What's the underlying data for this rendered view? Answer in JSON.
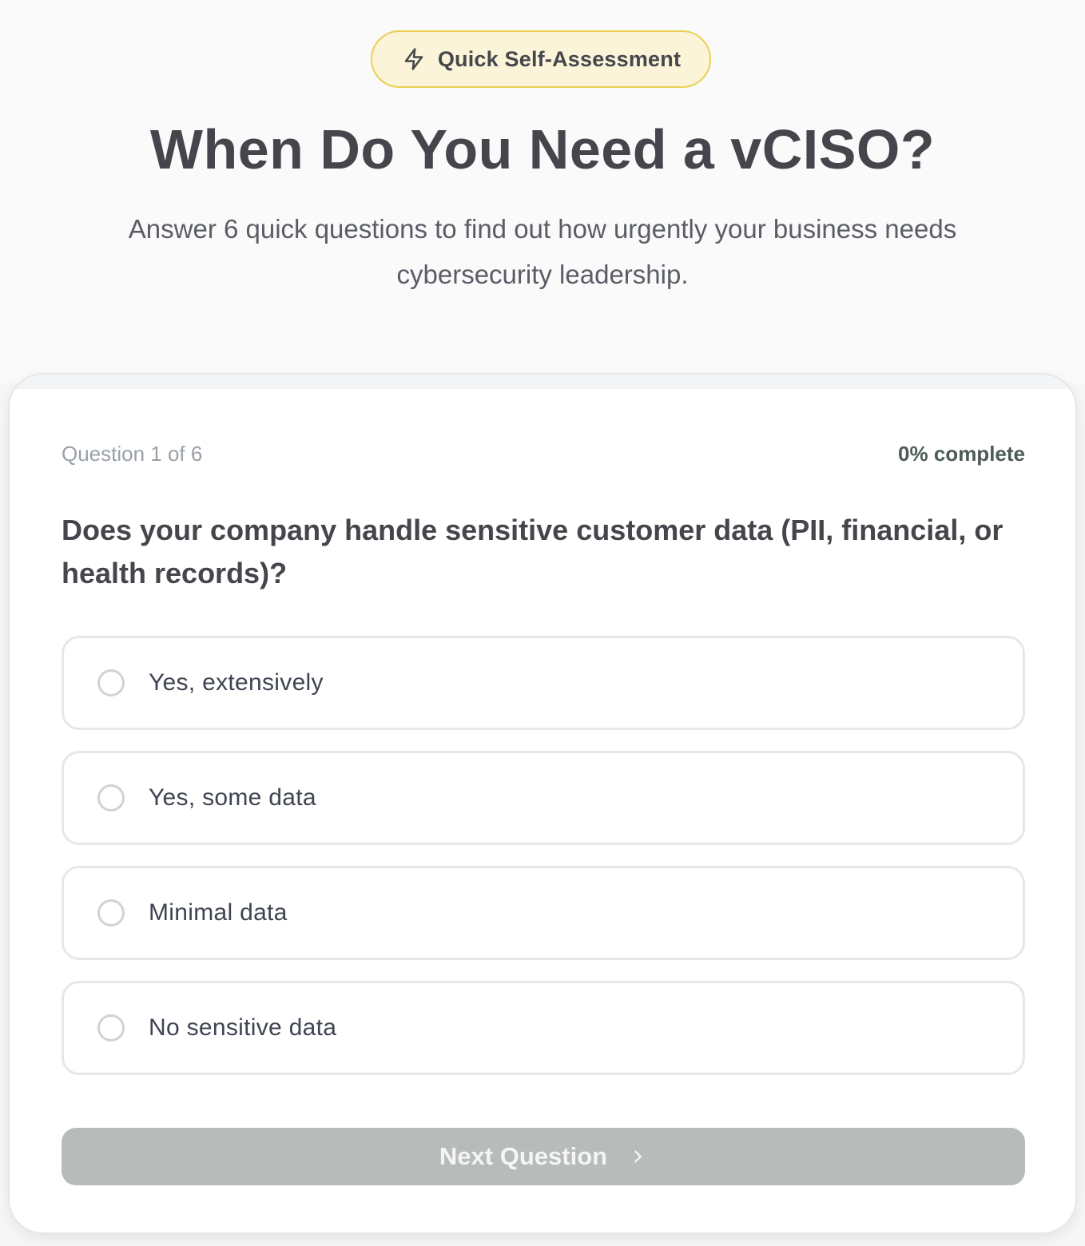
{
  "hero": {
    "badge": {
      "icon": "lightning-bolt-icon",
      "label": "Quick Self-Assessment",
      "border_color": "#ebcf55",
      "background_color": "#fbf4d8"
    },
    "title": "When Do You Need a vCISO?",
    "subtitle": "Answer 6 quick questions to find out how urgently your business needs cybersecurity leadership."
  },
  "quiz": {
    "question_counter": "Question 1 of 6",
    "progress_text": "0% complete",
    "progress_percent": 0,
    "question": "Does your company handle sensitive customer data (PII, financial, or health records)?",
    "options": [
      {
        "label": "Yes, extensively",
        "selected": false
      },
      {
        "label": "Yes, some data",
        "selected": false
      },
      {
        "label": "Minimal data",
        "selected": false
      },
      {
        "label": "No sensitive data",
        "selected": false
      }
    ],
    "next_button": {
      "label": "Next Question",
      "icon": "chevron-right-icon",
      "disabled": true,
      "background_color": "#b7bcba"
    }
  }
}
